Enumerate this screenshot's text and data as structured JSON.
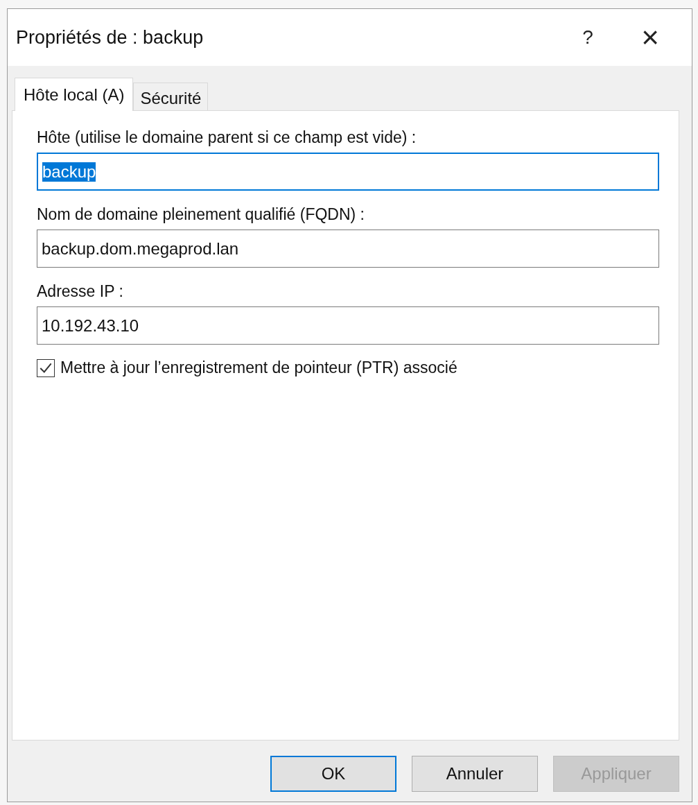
{
  "window": {
    "title": "Propriétés de : backup",
    "help": "?",
    "close": "×"
  },
  "tabs": [
    {
      "label": "Hôte local (A)",
      "selected": true
    },
    {
      "label": "Sécurité",
      "selected": false
    }
  ],
  "fields": [
    {
      "label": "Hôte (utilise le domaine parent si ce champ est vide) :",
      "value": "backup",
      "focused": true,
      "value_selected": true
    },
    {
      "label": "Nom de domaine pleinement qualifié (FQDN) :",
      "value": "backup.dom.megaprod.lan",
      "focused": false,
      "value_selected": false
    },
    {
      "label": "Adresse IP :",
      "value": "10.192.43.10",
      "focused": false,
      "value_selected": false
    }
  ],
  "checkbox": {
    "label": "Mettre à jour l’enregistrement de pointeur (PTR) associé",
    "checked": true
  },
  "buttons": [
    {
      "label": "OK",
      "default": true,
      "disabled": false
    },
    {
      "label": "Annuler",
      "default": false,
      "disabled": false
    },
    {
      "label": "Appliquer",
      "default": false,
      "disabled": true
    }
  ]
}
